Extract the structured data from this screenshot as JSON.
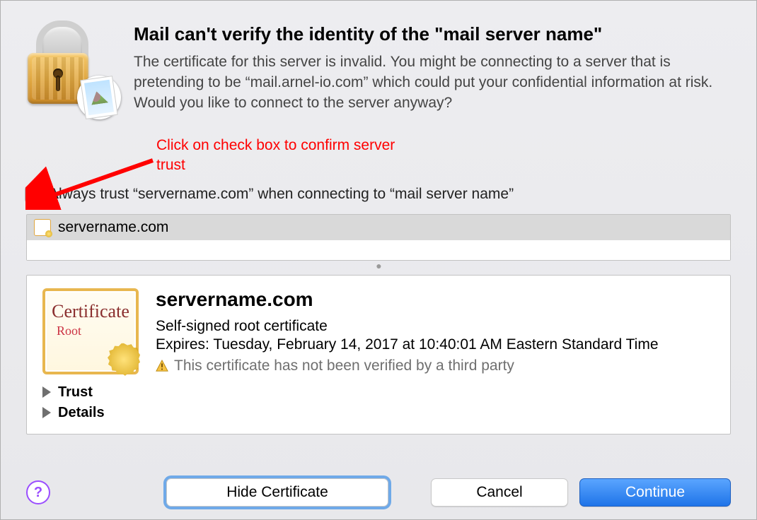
{
  "header": {
    "title": "Mail can't verify the identity of the \"mail server name\"",
    "description": "The certificate for this server is invalid. You might be connecting to a server that is pretending to be “mail.arnel-io.com” which could put your confidential information at risk. Would you like to connect to the server anyway?"
  },
  "annotation": {
    "text": "Click on check box to confirm server trust"
  },
  "trust_checkbox": {
    "label": "Always trust “servername.com” when connecting to “mail server name”",
    "checked": false
  },
  "cert_list": {
    "items": [
      "servername.com"
    ]
  },
  "certificate": {
    "name": "servername.com",
    "kind": "Self-signed root certificate",
    "expires": "Expires: Tuesday, February 14, 2017 at 10:40:01 AM Eastern Standard Time",
    "warning": "This certificate has not been verified by a third party",
    "badge_title": "Certificate",
    "badge_sub": "Root"
  },
  "disclosure": {
    "trust": "Trust",
    "details": "Details"
  },
  "buttons": {
    "help": "?",
    "hide": "Hide Certificate",
    "cancel": "Cancel",
    "continue": "Continue"
  }
}
